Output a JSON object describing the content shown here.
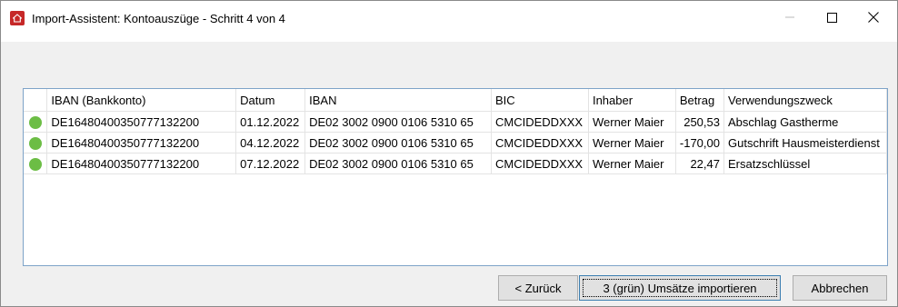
{
  "window": {
    "title": "Import-Assistent: Kontoauszüge - Schritt 4 von 4",
    "app_icon": "house-icon"
  },
  "grid": {
    "columns": [
      "",
      "IBAN (Bankkonto)",
      "Datum",
      "IBAN",
      "BIC",
      "Inhaber",
      "Betrag",
      "Verwendungszweck"
    ],
    "rows": [
      {
        "status": "green",
        "iban_konto": "DE16480400350777132200",
        "datum": "01.12.2022",
        "iban": "DE02 3002 0900 0106 5310 65",
        "bic": "CMCIDEDDXXX",
        "inhaber": "Werner Maier",
        "betrag": "250,53",
        "zweck": "Abschlag Gastherme"
      },
      {
        "status": "green",
        "iban_konto": "DE16480400350777132200",
        "datum": "04.12.2022",
        "iban": "DE02 3002 0900 0106 5310 65",
        "bic": "CMCIDEDDXXX",
        "inhaber": "Werner Maier",
        "betrag": "-170,00",
        "zweck": "Gutschrift Hausmeisterdienst"
      },
      {
        "status": "green",
        "iban_konto": "DE16480400350777132200",
        "datum": "07.12.2022",
        "iban": "DE02 3002 0900 0106 5310 65",
        "bic": "CMCIDEDDXXX",
        "inhaber": "Werner Maier",
        "betrag": "22,47",
        "zweck": "Ersatzschlüssel"
      }
    ],
    "status_color": "#6cbd45"
  },
  "buttons": {
    "back": "< Zurück",
    "import": "3 (grün) Umsätze importieren",
    "cancel": "Abbrechen"
  }
}
